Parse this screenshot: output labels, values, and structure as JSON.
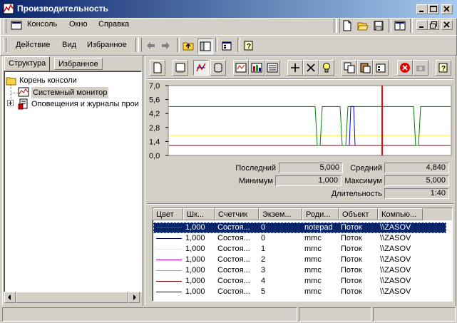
{
  "window": {
    "title": "Производительность",
    "controls": [
      "minimize",
      "maximize",
      "close"
    ]
  },
  "menubar": {
    "items": [
      "Консоль",
      "Окно",
      "Справка"
    ]
  },
  "actionbar": {
    "items": [
      "Действие",
      "Вид",
      "Избранное"
    ]
  },
  "left_pane": {
    "tabs": [
      "Структура",
      "Избранное"
    ],
    "active_tab": "Структура",
    "tree": [
      {
        "label": "Корень консоли",
        "icon": "folder-icon",
        "level": 0
      },
      {
        "label": "Системный монитор",
        "icon": "monitor-chart-icon",
        "level": 1,
        "selected": true
      },
      {
        "label": "Оповещения и журналы прои",
        "icon": "alerts-logs-icon",
        "level": 1,
        "expandable": true
      }
    ]
  },
  "chart_data": {
    "type": "line",
    "y_ticks": [
      "7,0",
      "5,6",
      "4,2",
      "2,8",
      "1,4",
      "0,0"
    ],
    "ylim": [
      0,
      7
    ],
    "grid": false,
    "series": [
      {
        "color": "#008000",
        "segments": [
          [
            4.9,
            4.9,
            1.0,
            1.0,
            4.9,
            4.9,
            1.0,
            1.0,
            4.9,
            4.9,
            1.0,
            1.0,
            4.9,
            4.9
          ]
        ]
      },
      {
        "color": "#ffff00",
        "values": [
          2.0
        ]
      },
      {
        "color": "#800000",
        "values": [
          1.0
        ]
      },
      {
        "color": "#0000ff",
        "values": [
          1.0,
          4.9,
          1.0
        ]
      }
    ],
    "current_time_marker": true
  },
  "stats": {
    "last_label": "Последний",
    "last_value": "5,000",
    "avg_label": "Средний",
    "avg_value": "4,840",
    "min_label": "Минимум",
    "min_value": "1,000",
    "max_label": "Максимум",
    "max_value": "5,000",
    "duration_label": "Длительность",
    "duration_value": "1:40"
  },
  "counter_table": {
    "headers": [
      "Цвет",
      "Шк...",
      "Счетчик",
      "Экзем...",
      "Роди...",
      "Объект",
      "Компью..."
    ],
    "rows": [
      {
        "color": "#008000",
        "scale": "1,000",
        "counter": "Состоя...",
        "instance": "0",
        "parent": "notepad",
        "object": "Поток",
        "computer": "\\\\ZASOV",
        "selected": true
      },
      {
        "color": "#000080",
        "scale": "1,000",
        "counter": "Состоя...",
        "instance": "0",
        "parent": "mmc",
        "object": "Поток",
        "computer": "\\\\ZASOV"
      },
      {
        "color": "#ffff00",
        "scale": "1,000",
        "counter": "Состоя...",
        "instance": "1",
        "parent": "mmc",
        "object": "Поток",
        "computer": "\\\\ZASOV"
      },
      {
        "color": "#c000c0",
        "scale": "1,000",
        "counter": "Состоя...",
        "instance": "2",
        "parent": "mmc",
        "object": "Поток",
        "computer": "\\\\ZASOV"
      },
      {
        "color": "#00e0e0",
        "scale": "1,000",
        "counter": "Состоя...",
        "instance": "3",
        "parent": "mmc",
        "object": "Поток",
        "computer": "\\\\ZASOV"
      },
      {
        "color": "#800000",
        "scale": "1,000",
        "counter": "Состоя...",
        "instance": "4",
        "parent": "mmc",
        "object": "Поток",
        "computer": "\\\\ZASOV"
      },
      {
        "color": "#000080",
        "scale": "1,000",
        "counter": "Состоя...",
        "instance": "5",
        "parent": "mmc",
        "object": "Поток",
        "computer": "\\\\ZASOV"
      }
    ]
  }
}
